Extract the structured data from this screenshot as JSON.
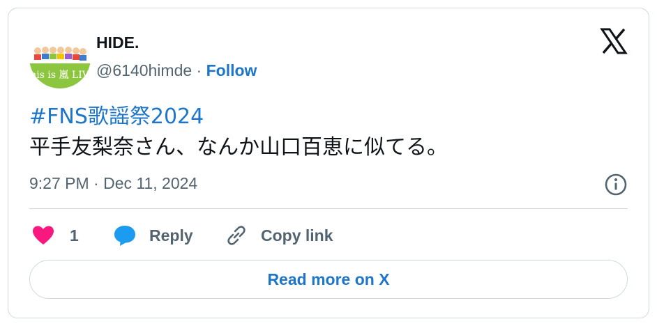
{
  "tweet": {
    "author": {
      "display_name": "HIDE.",
      "handle": "@6140himde",
      "separator": " · ",
      "follow_label": "Follow",
      "avatar_label": "This is 嵐 LIVE"
    },
    "hashtag": "#FNS歌謡祭2024",
    "body": "平手友梨奈さん、なんか山口百恵に似てる。",
    "timestamp": "9:27 PM · Dec 11, 2024",
    "logo_icon": "x-logo-icon",
    "info_icon": "info-icon"
  },
  "actions": {
    "like_count": "1",
    "reply_label": "Reply",
    "copy_link_label": "Copy link"
  },
  "footer": {
    "read_more_label": "Read more on X"
  },
  "colors": {
    "accent": "#1d76c9",
    "like": "#f91880",
    "muted_text": "#536471",
    "border": "#cfd9de",
    "avatar_green": "#8cc63f"
  }
}
